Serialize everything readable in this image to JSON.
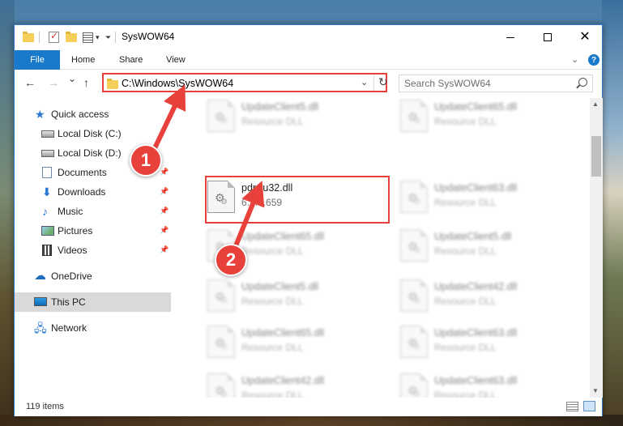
{
  "window": {
    "title": "SysWOW64",
    "controls": {
      "minimize": "minimize",
      "maximize": "maximize",
      "close": "✕"
    }
  },
  "quick_access_toolbar": {
    "icons": [
      "folder-icon",
      "properties-check-icon",
      "new-folder-icon",
      "properties-icon",
      "customize-caret-icon"
    ]
  },
  "ribbon": {
    "tabs": [
      {
        "label": "File"
      },
      {
        "label": "Home"
      },
      {
        "label": "Share"
      },
      {
        "label": "View"
      }
    ],
    "accent": "#1979ca"
  },
  "navigation": {
    "back": "←",
    "forward": "→",
    "recent": "⌄",
    "up": "↑"
  },
  "address_bar": {
    "path": "C:\\Windows\\SysWOW64",
    "highlight_color": "#e8403a"
  },
  "search": {
    "placeholder": "Search SysWOW64"
  },
  "sidebar": {
    "items": [
      {
        "label": "Quick access",
        "icon": "star-icon"
      },
      {
        "label": "Local Disk (C:)",
        "icon": "disk-icon"
      },
      {
        "label": "Local Disk (D:)",
        "icon": "disk-icon"
      },
      {
        "label": "Documents",
        "icon": "documents-icon",
        "pinned": true
      },
      {
        "label": "Downloads",
        "icon": "downloads-icon",
        "pinned": true
      },
      {
        "label": "Music",
        "icon": "music-icon",
        "pinned": true
      },
      {
        "label": "Pictures",
        "icon": "pictures-icon",
        "pinned": true
      },
      {
        "label": "Videos",
        "icon": "videos-icon",
        "pinned": true
      },
      {
        "label": "OneDrive",
        "icon": "onedrive-icon"
      },
      {
        "label": "This PC",
        "icon": "this-pc-icon",
        "selected": true
      },
      {
        "label": "Network",
        "icon": "network-icon"
      }
    ]
  },
  "files": {
    "left": [
      {
        "name": "UpdateClient5.dll",
        "sub": "Resource DLL"
      },
      {
        "name": "pdrrru32.dll",
        "sub": "6.1.3.659",
        "highlighted": true
      },
      {
        "name": "UpdateClient65.dll",
        "sub": "Resource DLL"
      },
      {
        "name": "UpdateClient5.dll",
        "sub": "Resource DLL"
      },
      {
        "name": "UpdateClient65.dll",
        "sub": "Resource DLL"
      },
      {
        "name": "UpdateClient42.dll",
        "sub": "Resource DLL"
      }
    ],
    "right": [
      {
        "name": "UpdateClient65.dll",
        "sub": "Resource DLL"
      },
      {
        "name": "UpdateClient63.dll",
        "sub": "Resource DLL"
      },
      {
        "name": "UpdateClient5.dll",
        "sub": "Resource DLL"
      },
      {
        "name": "UpdateClient42.dll",
        "sub": "Resource DLL"
      },
      {
        "name": "UpdateClient63.dll",
        "sub": "Resource DLL"
      },
      {
        "name": "UpdateClient63.dll",
        "sub": "Resource DLL"
      }
    ]
  },
  "status": {
    "item_count": "119 items"
  },
  "annotations": {
    "badge_1": "1",
    "badge_2": "2",
    "arrow_color": "#e8403a"
  }
}
